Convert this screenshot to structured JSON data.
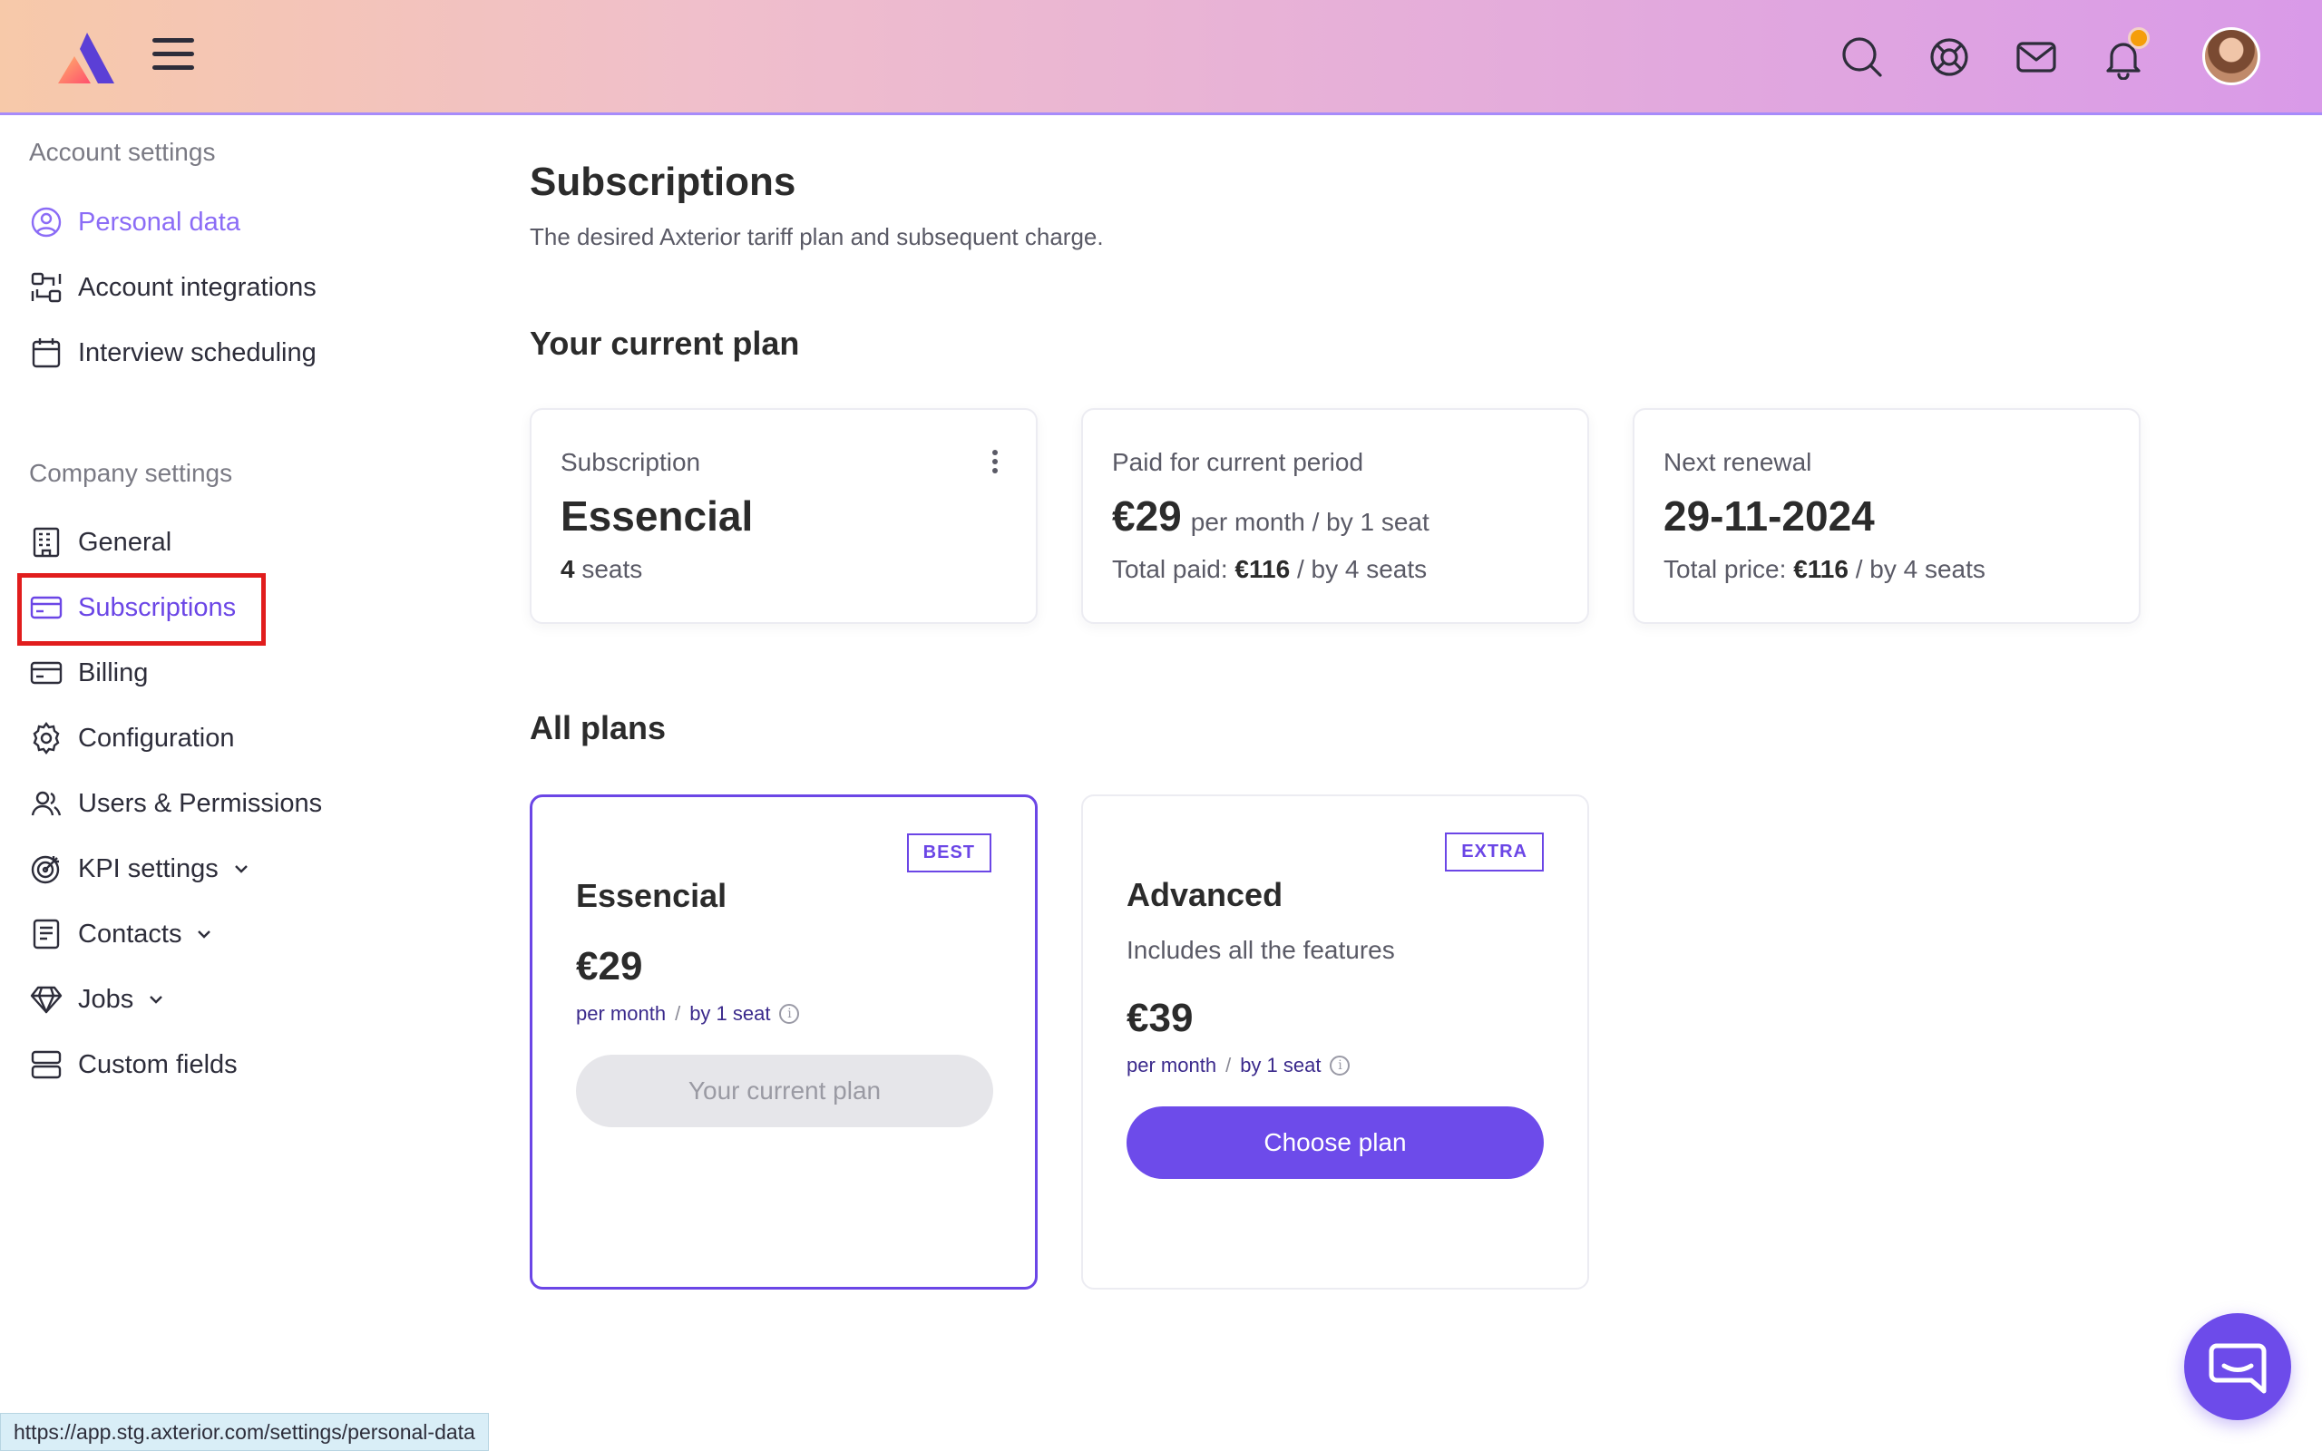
{
  "topbar": {
    "icons": [
      "search-icon",
      "support-icon",
      "mail-icon",
      "bell-icon"
    ],
    "accent_gradient": [
      "#f7c9a9",
      "#d99ae8"
    ],
    "notification_dot_color": "#f59e0b"
  },
  "sidebar": {
    "account_title": "Account settings",
    "account_items": [
      {
        "label": "Personal data",
        "icon": "user-circle-icon"
      },
      {
        "label": "Account integrations",
        "icon": "integrations-icon"
      },
      {
        "label": "Interview scheduling",
        "icon": "calendar-icon"
      }
    ],
    "company_title": "Company settings",
    "company_items": [
      {
        "label": "General",
        "icon": "building-icon"
      },
      {
        "label": "Subscriptions",
        "icon": "card-icon"
      },
      {
        "label": "Billing",
        "icon": "billing-card-icon"
      },
      {
        "label": "Configuration",
        "icon": "gear-icon"
      },
      {
        "label": "Users & Permissions",
        "icon": "users-icon"
      },
      {
        "label": "KPI settings",
        "icon": "target-icon"
      },
      {
        "label": "Contacts",
        "icon": "document-icon"
      },
      {
        "label": "Jobs",
        "icon": "diamond-icon"
      },
      {
        "label": "Custom fields",
        "icon": "fields-icon"
      }
    ]
  },
  "main": {
    "title": "Subscriptions",
    "subtitle": "The desired Axterior tariff plan and subsequent charge.",
    "current_plan_heading": "Your current plan",
    "current": {
      "subscription_label": "Subscription",
      "plan_name": "Essencial",
      "seats_count": "4",
      "seats_suffix": "seats",
      "paid_label": "Paid for current period",
      "paid_amount": "€29",
      "paid_per": "per month / by 1 seat",
      "total_paid_label": "Total paid:",
      "total_paid_amount": "€116",
      "total_paid_suffix": "/ by 4 seats",
      "renewal_label": "Next renewal",
      "renewal_date": "29-11-2024",
      "total_price_label": "Total price:",
      "total_price_amount": "€116",
      "total_price_suffix": "/ by 4 seats"
    },
    "all_plans_heading": "All plans",
    "plans": [
      {
        "badge": "BEST",
        "name": "Essencial",
        "price": "€29",
        "per_month": "per month",
        "sep": "/",
        "by_seat": "by 1 seat",
        "button": "Your current plan"
      },
      {
        "badge": "EXTRA",
        "name": "Advanced",
        "description": "Includes all the features",
        "price": "€39",
        "per_month": "per month",
        "sep": "/",
        "by_seat": "by 1 seat",
        "button": "Choose plan"
      }
    ]
  },
  "status_url": "https://app.stg.axterior.com/settings/personal-data",
  "colors": {
    "accent": "#6d4bea",
    "active_link": "#8b6cf6",
    "highlight": "#e11d1d"
  }
}
